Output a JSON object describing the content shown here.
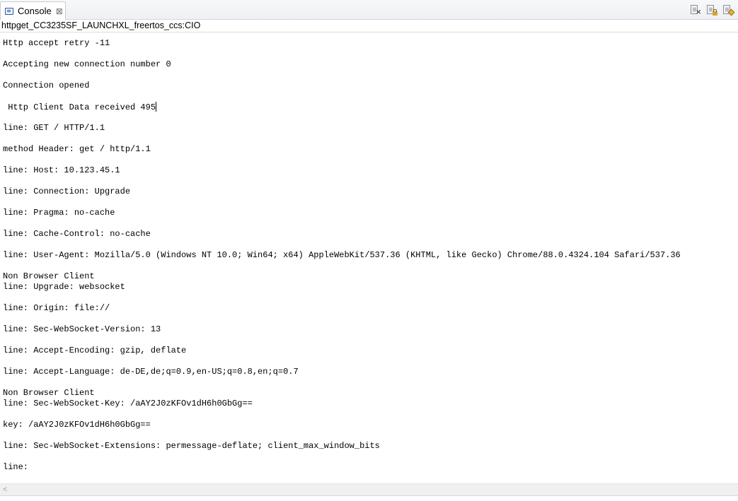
{
  "tab": {
    "label": "Console",
    "close_glyph": "⊠"
  },
  "toolbar": {
    "buttons": [
      {
        "name": "clear-console-button",
        "icon": "clear-console-icon"
      },
      {
        "name": "scroll-lock-button",
        "icon": "scroll-lock-icon"
      },
      {
        "name": "pin-console-button",
        "icon": "pin-console-icon"
      }
    ]
  },
  "session": {
    "title": "httpget_CC3235SF_LAUNCHXL_freertos_ccs:CIO"
  },
  "console": {
    "lines": [
      {
        "text": "Http accept retry -11",
        "row": 0
      },
      {
        "text": "Accepting new connection number 0",
        "row": 2
      },
      {
        "text": "Connection opened",
        "row": 4
      },
      {
        "text": " Http Client Data received 495",
        "row": 6,
        "caret": true
      },
      {
        "text": "line: GET / HTTP/1.1",
        "row": 8
      },
      {
        "text": "method Header: get / http/1.1",
        "row": 10
      },
      {
        "text": "line: Host: 10.123.45.1",
        "row": 12
      },
      {
        "text": "line: Connection: Upgrade",
        "row": 14
      },
      {
        "text": "line: Pragma: no-cache",
        "row": 16
      },
      {
        "text": "line: Cache-Control: no-cache",
        "row": 18
      },
      {
        "text": "line: User-Agent: Mozilla/5.0 (Windows NT 10.0; Win64; x64) AppleWebKit/537.36 (KHTML, like Gecko) Chrome/88.0.4324.104 Safari/537.36",
        "row": 20
      },
      {
        "text": "Non Browser Client",
        "row": 22
      },
      {
        "text": "line: Upgrade: websocket",
        "row": 23
      },
      {
        "text": "line: Origin: file://",
        "row": 25
      },
      {
        "text": "line: Sec-WebSocket-Version: 13",
        "row": 27
      },
      {
        "text": "line: Accept-Encoding: gzip, deflate",
        "row": 29
      },
      {
        "text": "line: Accept-Language: de-DE,de;q=0.9,en-US;q=0.8,en;q=0.7",
        "row": 31
      },
      {
        "text": "Non Browser Client",
        "row": 33
      },
      {
        "text": "line: Sec-WebSocket-Key: /aAY2J0zKFOv1dH6h0GbGg==",
        "row": 34
      },
      {
        "text": "key: /aAY2J0zKFOv1dH6h0GbGg==",
        "row": 36
      },
      {
        "text": "line: Sec-WebSocket-Extensions: permessage-deflate; client_max_window_bits",
        "row": 38
      },
      {
        "text": "line:",
        "row": 40
      }
    ]
  },
  "scrollbar": {
    "left_arrow": "<"
  }
}
